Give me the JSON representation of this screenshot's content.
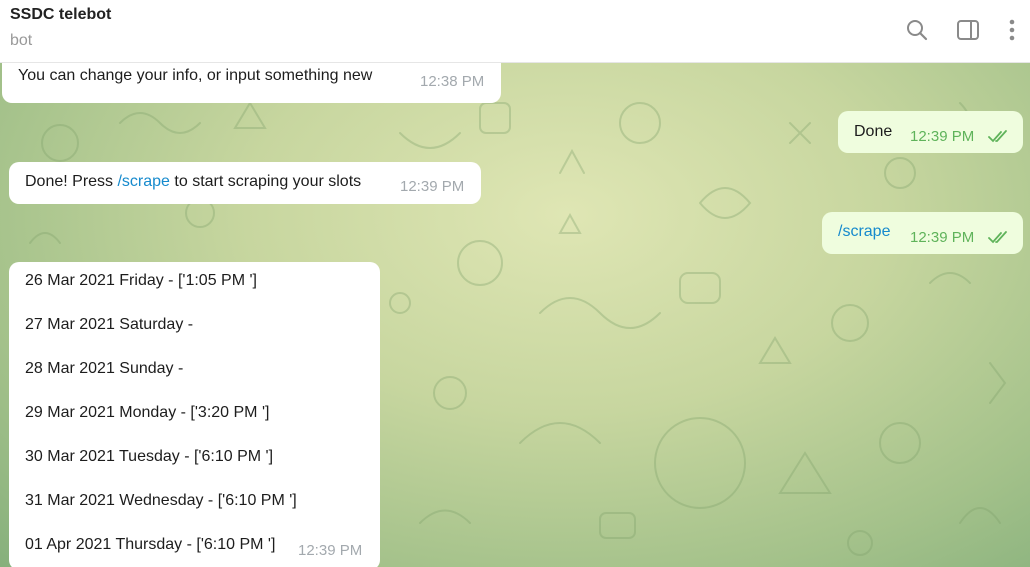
{
  "header": {
    "title": "SSDC telebot",
    "subtitle": "bot",
    "icons": [
      "search-icon",
      "sidebar-toggle-icon",
      "more-vertical-icon"
    ]
  },
  "messages": {
    "m1": {
      "text": "You can change your info, or input something new",
      "time": "12:38 PM"
    },
    "m2": {
      "text": "Done",
      "time": "12:39 PM"
    },
    "m3": {
      "text_before": "Done! Press ",
      "command": "/scrape",
      "text_after": " to start scraping your slots",
      "time": "12:39 PM"
    },
    "m4": {
      "command": "/scrape",
      "time": "12:39 PM"
    },
    "m5": {
      "lines": [
        "26 Mar 2021 Friday - ['1:05 PM ']",
        "27 Mar 2021 Saturday -",
        "28 Mar 2021 Sunday -",
        "29 Mar 2021 Monday - ['3:20 PM ']",
        "30 Mar 2021 Tuesday - ['6:10 PM ']",
        "31 Mar 2021 Wednesday - ['6:10 PM ']",
        "01 Apr 2021 Thursday - ['6:10 PM ']"
      ],
      "time": "12:39 PM"
    }
  },
  "colors": {
    "incoming_bubble": "#ffffff",
    "outgoing_bubble": "#effdde",
    "link": "#168acd",
    "outgoing_time": "#5fb35a"
  }
}
